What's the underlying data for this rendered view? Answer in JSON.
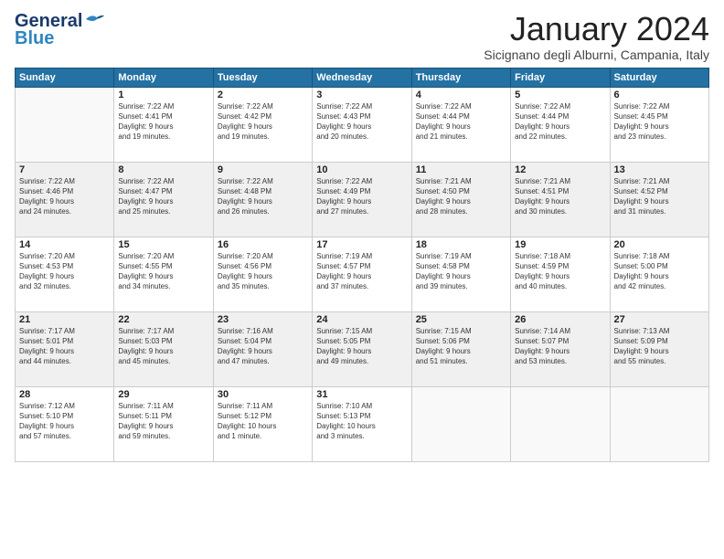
{
  "logo": {
    "line1": "General",
    "line2": "Blue"
  },
  "title": {
    "month_year": "January 2024",
    "location": "Sicignano degli Alburni, Campania, Italy"
  },
  "weekdays": [
    "Sunday",
    "Monday",
    "Tuesday",
    "Wednesday",
    "Thursday",
    "Friday",
    "Saturday"
  ],
  "weeks": [
    {
      "shaded": false,
      "days": [
        {
          "num": "",
          "sunrise": "",
          "sunset": "",
          "daylight": ""
        },
        {
          "num": "1",
          "sunrise": "Sunrise: 7:22 AM",
          "sunset": "Sunset: 4:41 PM",
          "daylight": "Daylight: 9 hours and 19 minutes."
        },
        {
          "num": "2",
          "sunrise": "Sunrise: 7:22 AM",
          "sunset": "Sunset: 4:42 PM",
          "daylight": "Daylight: 9 hours and 19 minutes."
        },
        {
          "num": "3",
          "sunrise": "Sunrise: 7:22 AM",
          "sunset": "Sunset: 4:43 PM",
          "daylight": "Daylight: 9 hours and 20 minutes."
        },
        {
          "num": "4",
          "sunrise": "Sunrise: 7:22 AM",
          "sunset": "Sunset: 4:44 PM",
          "daylight": "Daylight: 9 hours and 21 minutes."
        },
        {
          "num": "5",
          "sunrise": "Sunrise: 7:22 AM",
          "sunset": "Sunset: 4:44 PM",
          "daylight": "Daylight: 9 hours and 22 minutes."
        },
        {
          "num": "6",
          "sunrise": "Sunrise: 7:22 AM",
          "sunset": "Sunset: 4:45 PM",
          "daylight": "Daylight: 9 hours and 23 minutes."
        }
      ]
    },
    {
      "shaded": true,
      "days": [
        {
          "num": "7",
          "sunrise": "Sunrise: 7:22 AM",
          "sunset": "Sunset: 4:46 PM",
          "daylight": "Daylight: 9 hours and 24 minutes."
        },
        {
          "num": "8",
          "sunrise": "Sunrise: 7:22 AM",
          "sunset": "Sunset: 4:47 PM",
          "daylight": "Daylight: 9 hours and 25 minutes."
        },
        {
          "num": "9",
          "sunrise": "Sunrise: 7:22 AM",
          "sunset": "Sunset: 4:48 PM",
          "daylight": "Daylight: 9 hours and 26 minutes."
        },
        {
          "num": "10",
          "sunrise": "Sunrise: 7:22 AM",
          "sunset": "Sunset: 4:49 PM",
          "daylight": "Daylight: 9 hours and 27 minutes."
        },
        {
          "num": "11",
          "sunrise": "Sunrise: 7:21 AM",
          "sunset": "Sunset: 4:50 PM",
          "daylight": "Daylight: 9 hours and 28 minutes."
        },
        {
          "num": "12",
          "sunrise": "Sunrise: 7:21 AM",
          "sunset": "Sunset: 4:51 PM",
          "daylight": "Daylight: 9 hours and 30 minutes."
        },
        {
          "num": "13",
          "sunrise": "Sunrise: 7:21 AM",
          "sunset": "Sunset: 4:52 PM",
          "daylight": "Daylight: 9 hours and 31 minutes."
        }
      ]
    },
    {
      "shaded": false,
      "days": [
        {
          "num": "14",
          "sunrise": "Sunrise: 7:20 AM",
          "sunset": "Sunset: 4:53 PM",
          "daylight": "Daylight: 9 hours and 32 minutes."
        },
        {
          "num": "15",
          "sunrise": "Sunrise: 7:20 AM",
          "sunset": "Sunset: 4:55 PM",
          "daylight": "Daylight: 9 hours and 34 minutes."
        },
        {
          "num": "16",
          "sunrise": "Sunrise: 7:20 AM",
          "sunset": "Sunset: 4:56 PM",
          "daylight": "Daylight: 9 hours and 35 minutes."
        },
        {
          "num": "17",
          "sunrise": "Sunrise: 7:19 AM",
          "sunset": "Sunset: 4:57 PM",
          "daylight": "Daylight: 9 hours and 37 minutes."
        },
        {
          "num": "18",
          "sunrise": "Sunrise: 7:19 AM",
          "sunset": "Sunset: 4:58 PM",
          "daylight": "Daylight: 9 hours and 39 minutes."
        },
        {
          "num": "19",
          "sunrise": "Sunrise: 7:18 AM",
          "sunset": "Sunset: 4:59 PM",
          "daylight": "Daylight: 9 hours and 40 minutes."
        },
        {
          "num": "20",
          "sunrise": "Sunrise: 7:18 AM",
          "sunset": "Sunset: 5:00 PM",
          "daylight": "Daylight: 9 hours and 42 minutes."
        }
      ]
    },
    {
      "shaded": true,
      "days": [
        {
          "num": "21",
          "sunrise": "Sunrise: 7:17 AM",
          "sunset": "Sunset: 5:01 PM",
          "daylight": "Daylight: 9 hours and 44 minutes."
        },
        {
          "num": "22",
          "sunrise": "Sunrise: 7:17 AM",
          "sunset": "Sunset: 5:03 PM",
          "daylight": "Daylight: 9 hours and 45 minutes."
        },
        {
          "num": "23",
          "sunrise": "Sunrise: 7:16 AM",
          "sunset": "Sunset: 5:04 PM",
          "daylight": "Daylight: 9 hours and 47 minutes."
        },
        {
          "num": "24",
          "sunrise": "Sunrise: 7:15 AM",
          "sunset": "Sunset: 5:05 PM",
          "daylight": "Daylight: 9 hours and 49 minutes."
        },
        {
          "num": "25",
          "sunrise": "Sunrise: 7:15 AM",
          "sunset": "Sunset: 5:06 PM",
          "daylight": "Daylight: 9 hours and 51 minutes."
        },
        {
          "num": "26",
          "sunrise": "Sunrise: 7:14 AM",
          "sunset": "Sunset: 5:07 PM",
          "daylight": "Daylight: 9 hours and 53 minutes."
        },
        {
          "num": "27",
          "sunrise": "Sunrise: 7:13 AM",
          "sunset": "Sunset: 5:09 PM",
          "daylight": "Daylight: 9 hours and 55 minutes."
        }
      ]
    },
    {
      "shaded": false,
      "days": [
        {
          "num": "28",
          "sunrise": "Sunrise: 7:12 AM",
          "sunset": "Sunset: 5:10 PM",
          "daylight": "Daylight: 9 hours and 57 minutes."
        },
        {
          "num": "29",
          "sunrise": "Sunrise: 7:11 AM",
          "sunset": "Sunset: 5:11 PM",
          "daylight": "Daylight: 9 hours and 59 minutes."
        },
        {
          "num": "30",
          "sunrise": "Sunrise: 7:11 AM",
          "sunset": "Sunset: 5:12 PM",
          "daylight": "Daylight: 10 hours and 1 minute."
        },
        {
          "num": "31",
          "sunrise": "Sunrise: 7:10 AM",
          "sunset": "Sunset: 5:13 PM",
          "daylight": "Daylight: 10 hours and 3 minutes."
        },
        {
          "num": "",
          "sunrise": "",
          "sunset": "",
          "daylight": ""
        },
        {
          "num": "",
          "sunrise": "",
          "sunset": "",
          "daylight": ""
        },
        {
          "num": "",
          "sunrise": "",
          "sunset": "",
          "daylight": ""
        }
      ]
    }
  ]
}
